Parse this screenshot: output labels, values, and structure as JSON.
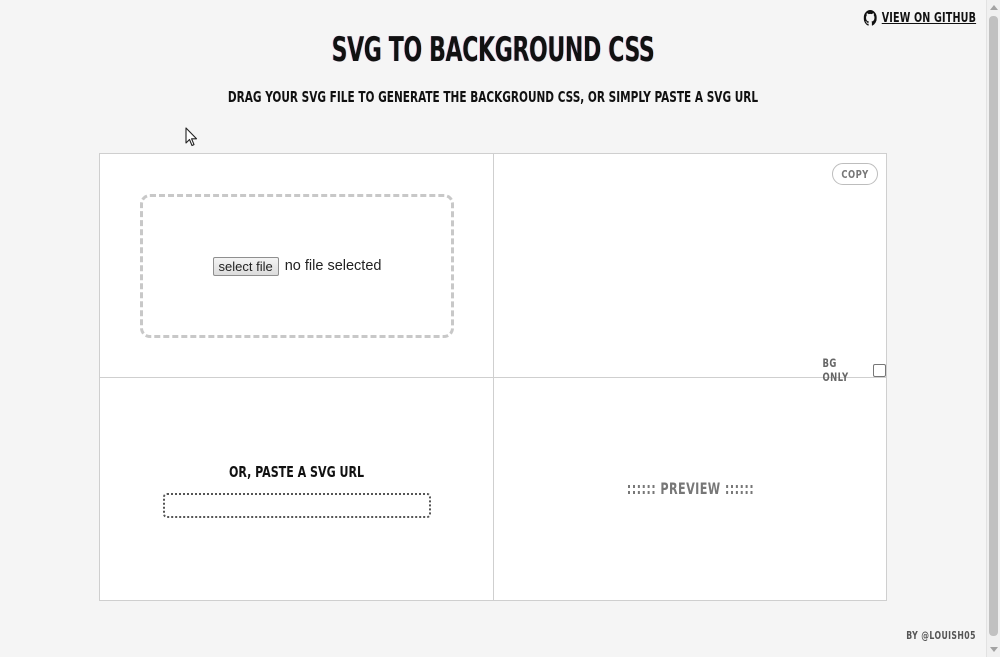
{
  "header": {
    "github_link": "VIEW ON GITHUB",
    "title": "SVG TO BACKGROUND CSS",
    "subtitle": "DRAG YOUR SVG FILE TO GENERATE THE BACKGROUND CSS, OR SIMPLY PASTE A SVG URL"
  },
  "upload": {
    "button_label": "select file",
    "status": "no file selected"
  },
  "output": {
    "copy_label": "COPY",
    "bg_only_label": "BG ONLY",
    "bg_only_checked": false
  },
  "url": {
    "label": "OR, PASTE A SVG URL",
    "value": ""
  },
  "preview": {
    "label": ":::::: PREVIEW ::::::"
  },
  "footer": {
    "credit": "BY @LOUISH05"
  },
  "icons": {
    "github": "github-icon",
    "cursor": "mouse-pointer-icon"
  }
}
